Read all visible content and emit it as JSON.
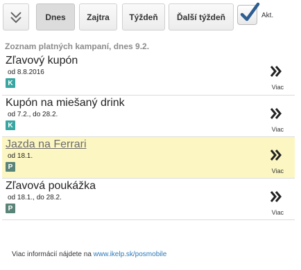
{
  "toolbar": {
    "collapse_icon": "double-chevron-down-icon",
    "buttons": [
      {
        "label": "Dnes",
        "active": true
      },
      {
        "label": "Zajtra",
        "active": false
      },
      {
        "label": "Týždeň",
        "active": false
      },
      {
        "label": "Ďalší týždeň",
        "active": false
      }
    ],
    "checkbox": {
      "label": "Akt.",
      "checked": true,
      "check_color": "#2e5d91"
    }
  },
  "subtitle": "Zoznam platných kampaní, dnes 9.2.",
  "campaigns": [
    {
      "title": "Zľavový kupón",
      "dates": "od 8.8.2016",
      "badge": "K",
      "badge_color": "#3aa6a2",
      "more": "Viac",
      "highlighted": false
    },
    {
      "title": "Kupón na miešaný drink",
      "dates": "od 7.2., do 28.2.",
      "badge": "K",
      "badge_color": "#3aa6a2",
      "more": "Viac",
      "highlighted": false
    },
    {
      "title": "Jazda na Ferrari",
      "dates": "od 18.1.",
      "badge": "P",
      "badge_color": "#5b8478",
      "more": "Viac",
      "highlighted": true
    },
    {
      "title": "Zľavová poukážka",
      "dates": "od 18.1., do 28.2.",
      "badge": "P",
      "badge_color": "#5b8478",
      "more": "Viac",
      "highlighted": false
    }
  ],
  "footer": {
    "text": "Viac informácií nájdete na ",
    "link": "www.ikelp.sk/posmobile",
    "link_color": "#2c79b8"
  },
  "colors": {
    "highlight_bg": "#fcf7c2",
    "subtitle": "#8c8c8c"
  }
}
